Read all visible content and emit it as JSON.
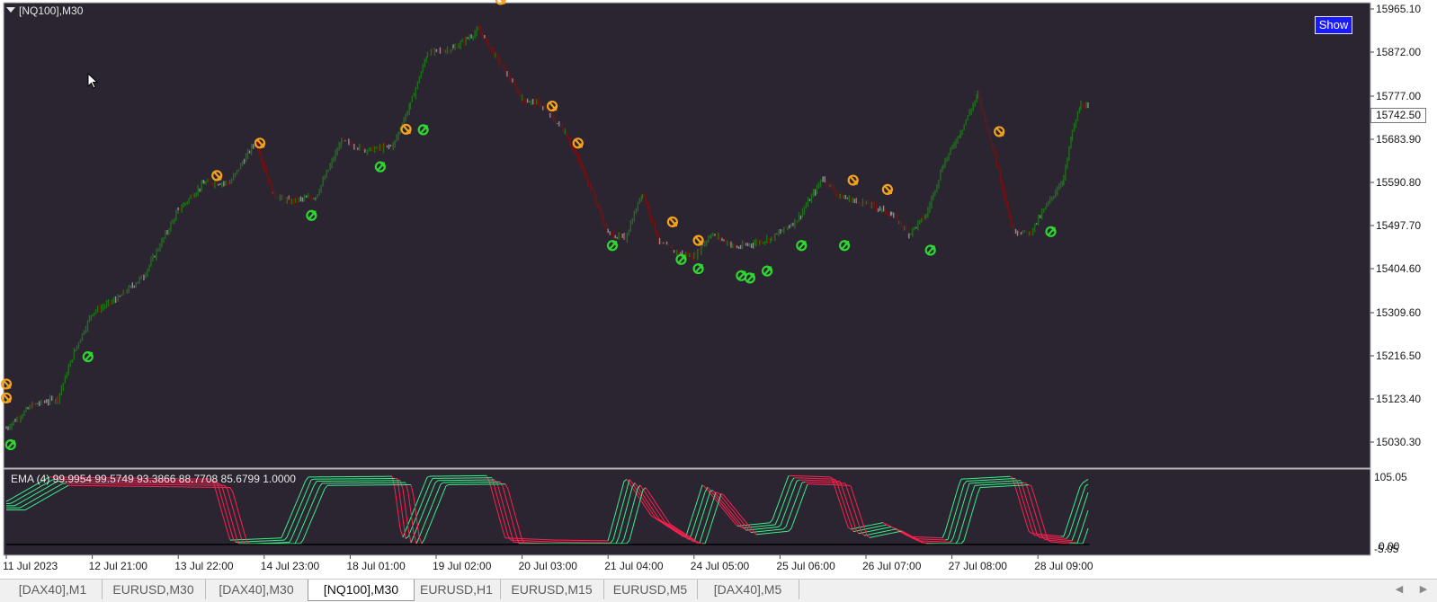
{
  "window": {
    "symbol_title": "[NQ100],M30",
    "show_button": "Show"
  },
  "colors": {
    "background": "#2a2531",
    "bull": "#1f6e1b",
    "bear": "#6e1313",
    "neutral": "#8a8a98",
    "buy_arrow": "#2fd62f",
    "sell_arrow": "#f4a21c",
    "osc_up": "#39f08a",
    "osc_down": "#ff2050"
  },
  "price_axis": {
    "labels": [
      "15965.10",
      "15872.00",
      "15777.00",
      "15683.90",
      "15590.80",
      "15497.70",
      "15404.60",
      "15309.60",
      "15216.50",
      "15123.40",
      "15030.30"
    ],
    "current_price": "15742.50"
  },
  "time_axis": {
    "labels": [
      "11 Jul 2023",
      "12 Jul 21:00",
      "13 Jul 22:00",
      "14 Jul 23:00",
      "18 Jul 01:00",
      "19 Jul 02:00",
      "20 Jul 03:00",
      "21 Jul 04:00",
      "24 Jul 05:00",
      "25 Jul 06:00",
      "26 Jul 07:00",
      "27 Jul 08:00",
      "28 Jul 09:00"
    ]
  },
  "indicator": {
    "label": "EMA (4) 99.9954 99.5749 93.3866 88.7708 85.6799 1.0000",
    "axis_top": "105.05",
    "axis_bottom": "-5.05",
    "axis_bottom_overlay": "0.00"
  },
  "tabs": [
    {
      "label": "[DAX40],M1",
      "active": false
    },
    {
      "label": "EURUSD,M30",
      "active": false
    },
    {
      "label": "[DAX40],M30",
      "active": false
    },
    {
      "label": "[NQ100],M30",
      "active": true
    },
    {
      "label": "EURUSD,H1",
      "active": false
    },
    {
      "label": "EURUSD,M15",
      "active": false
    },
    {
      "label": "EURUSD,M5",
      "active": false
    },
    {
      "label": "[DAX40],M5",
      "active": false
    }
  ],
  "nav_icons": [
    "chevron-left-icon",
    "chevron-right-icon"
  ],
  "chart_data": {
    "type": "line",
    "title": "[NQ100],M30",
    "y_unit": "price",
    "x": [
      "11 Jul 2023",
      "12 Jul 21:00",
      "13 Jul 22:00",
      "14 Jul 23:00",
      "18 Jul 01:00",
      "19 Jul 02:00",
      "20 Jul 03:00",
      "21 Jul 04:00",
      "24 Jul 05:00",
      "25 Jul 06:00",
      "26 Jul 07:00",
      "27 Jul 08:00",
      "28 Jul 09:00"
    ],
    "ylim": [
      15000,
      15980
    ],
    "series": [
      {
        "name": "price",
        "points": [
          [
            0,
            15060
          ],
          [
            0.3,
            15110
          ],
          [
            0.6,
            15125
          ],
          [
            0.8,
            15230
          ],
          [
            1.0,
            15310
          ],
          [
            1.3,
            15340
          ],
          [
            1.6,
            15390
          ],
          [
            2.0,
            15530
          ],
          [
            2.3,
            15590
          ],
          [
            2.6,
            15590
          ],
          [
            2.9,
            15680
          ],
          [
            3.1,
            15565
          ],
          [
            3.3,
            15550
          ],
          [
            3.6,
            15560
          ],
          [
            3.9,
            15680
          ],
          [
            4.2,
            15660
          ],
          [
            4.5,
            15670
          ],
          [
            4.7,
            15760
          ],
          [
            4.9,
            15870
          ],
          [
            5.2,
            15880
          ],
          [
            5.5,
            15920
          ],
          [
            5.7,
            15860
          ],
          [
            6.0,
            15770
          ],
          [
            6.2,
            15760
          ],
          [
            6.5,
            15700
          ],
          [
            6.8,
            15580
          ],
          [
            7.0,
            15480
          ],
          [
            7.2,
            15470
          ],
          [
            7.4,
            15570
          ],
          [
            7.6,
            15460
          ],
          [
            7.8,
            15440
          ],
          [
            8.0,
            15430
          ],
          [
            8.2,
            15480
          ],
          [
            8.5,
            15450
          ],
          [
            8.7,
            15460
          ],
          [
            8.9,
            15470
          ],
          [
            9.2,
            15510
          ],
          [
            9.5,
            15600
          ],
          [
            9.7,
            15560
          ],
          [
            9.9,
            15550
          ],
          [
            10.1,
            15540
          ],
          [
            10.3,
            15520
          ],
          [
            10.5,
            15480
          ],
          [
            10.7,
            15520
          ],
          [
            10.9,
            15630
          ],
          [
            11.1,
            15700
          ],
          [
            11.3,
            15780
          ],
          [
            11.5,
            15650
          ],
          [
            11.7,
            15490
          ],
          [
            11.9,
            15480
          ],
          [
            12.1,
            15540
          ],
          [
            12.3,
            15600
          ],
          [
            12.4,
            15700
          ],
          [
            12.5,
            15760
          ],
          [
            12.6,
            15750
          ]
        ]
      }
    ],
    "signals": {
      "buy": [
        [
          0.05,
          15040
        ],
        [
          0.95,
          15230
        ],
        [
          3.55,
          15535
        ],
        [
          4.35,
          15640
        ],
        [
          4.85,
          15720
        ],
        [
          7.05,
          15470
        ],
        [
          7.85,
          15440
        ],
        [
          8.05,
          15420
        ],
        [
          8.55,
          15405
        ],
        [
          8.65,
          15400
        ],
        [
          8.85,
          15415
        ],
        [
          9.25,
          15470
        ],
        [
          9.75,
          15470
        ],
        [
          10.75,
          15460
        ],
        [
          12.15,
          15500
        ]
      ],
      "sell": [
        [
          0.0,
          15140
        ],
        [
          0.0,
          15110
        ],
        [
          2.45,
          15590
        ],
        [
          2.95,
          15660
        ],
        [
          4.65,
          15690
        ],
        [
          5.75,
          15970
        ],
        [
          6.35,
          15740
        ],
        [
          6.65,
          15660
        ],
        [
          7.75,
          15490
        ],
        [
          8.05,
          15450
        ],
        [
          9.85,
          15580
        ],
        [
          10.25,
          15560
        ],
        [
          11.55,
          15685
        ]
      ]
    },
    "oscillator": {
      "name": "EMA (4)",
      "values": [
        99.9954,
        99.5749,
        93.3866,
        88.7708,
        85.6799,
        1.0
      ],
      "ylim": [
        -5.05,
        105.05
      ]
    }
  }
}
